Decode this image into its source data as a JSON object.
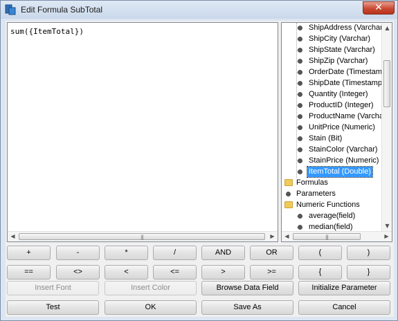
{
  "window": {
    "title": "Edit Formula SubTotal",
    "close_glyph": "✕",
    "app_icon": "database-icon"
  },
  "editor": {
    "content": "sum({ItemTotal})"
  },
  "tree": {
    "fields": [
      "ShipAddress (Varchar",
      "ShipCity (Varchar)",
      "ShipState (Varchar)",
      "ShipZip (Varchar)",
      "OrderDate (Timestam",
      "ShipDate (Timestamp",
      "Quantity (Integer)",
      "ProductID (Integer)",
      "ProductName (Varcha",
      "UnitPrice (Numeric)",
      "Stain (Bit)",
      "StainColor (Varchar)",
      "StainPrice (Numeric)",
      "ItemTotal (Double)"
    ],
    "selected": "ItemTotal (Double)",
    "groups": [
      {
        "label": "Formulas",
        "icon": "folder-icon"
      },
      {
        "label": "Parameters",
        "icon": "dot-icon"
      },
      {
        "label": "Numeric Functions",
        "icon": "folder-icon"
      }
    ],
    "functions": [
      "average(field)",
      "median(field)"
    ]
  },
  "operators": {
    "row1": [
      "+",
      "-",
      "*",
      "/",
      "AND",
      "OR",
      "(",
      ")"
    ],
    "row2": [
      "==",
      "<>",
      "<",
      "<=",
      ">",
      ">=",
      "{",
      "}"
    ]
  },
  "actions": {
    "insert_font": "Insert Font",
    "insert_color": "Insert Color",
    "browse_data_field": "Browse Data Field",
    "initialize_parameter": "Initialize Parameter"
  },
  "footer": {
    "test": "Test",
    "ok": "OK",
    "save_as": "Save As",
    "cancel": "Cancel"
  },
  "scroll_glyphs": {
    "left": "◀",
    "right": "▶",
    "up": "▲",
    "down": "▼",
    "grip": "|||"
  }
}
